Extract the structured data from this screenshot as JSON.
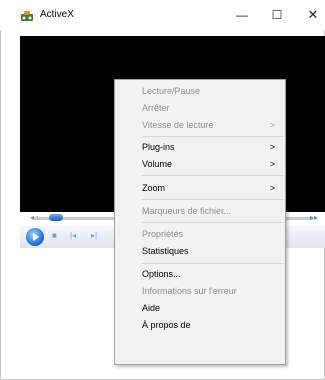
{
  "window": {
    "title": "ActiveX",
    "minimize_glyph": "—",
    "maximize_glyph": "☐",
    "close_glyph": "✕"
  },
  "colors": {
    "video_background": "#000000",
    "menu_background": "#f2f2f2",
    "disabled_text": "#8d8d8d",
    "accent": "#1c64c8"
  },
  "controls": {
    "seek_left_glyph": "◂◂",
    "seek_right_glyph": "▸▸",
    "stop_glyph": "■",
    "prev_glyph": "|◂",
    "next_glyph": "▸|",
    "seek_position_fraction": 0.08
  },
  "context_menu": {
    "submenu_arrow": ">",
    "items": [
      {
        "label": "Lecture/Pause",
        "enabled": false
      },
      {
        "label": "Arrêter",
        "enabled": false
      },
      {
        "label": "Vitesse de lecture",
        "enabled": false,
        "submenu": true
      },
      {
        "label": "Plug-ins",
        "enabled": true,
        "submenu": true
      },
      {
        "label": "Volume",
        "enabled": true,
        "submenu": true
      },
      {
        "label": "Zoom",
        "enabled": true,
        "submenu": true
      },
      {
        "label": "Marqueurs de fichier...",
        "enabled": false
      },
      {
        "label": "Propriétés",
        "enabled": false
      },
      {
        "label": "Statistiques",
        "enabled": true
      },
      {
        "label": "Options...",
        "enabled": true
      },
      {
        "label": "Informations sur l'erreur",
        "enabled": false
      },
      {
        "label": "Aide",
        "enabled": true
      },
      {
        "label": "À propos de",
        "enabled": true
      }
    ]
  }
}
